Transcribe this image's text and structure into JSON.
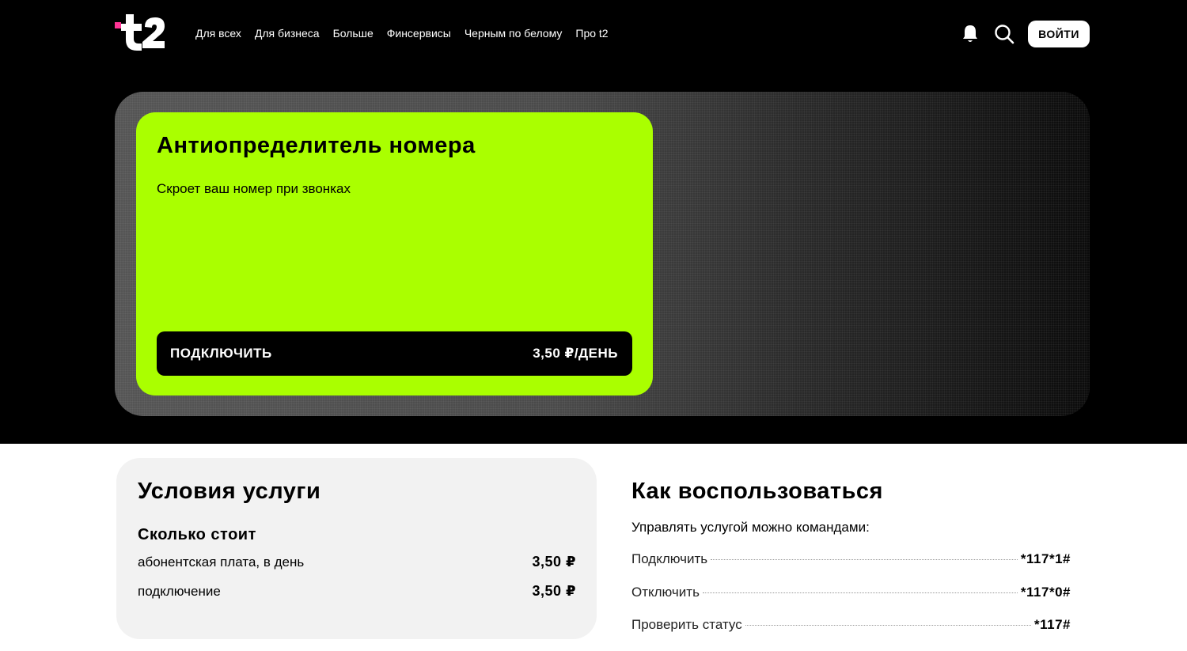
{
  "brand": {
    "logo_text": "t2",
    "accent_color": "#ff3495",
    "hero_color": "#aaff00"
  },
  "nav": {
    "items": [
      {
        "label": "Для всех"
      },
      {
        "label": "Для бизнеса"
      },
      {
        "label": "Больше"
      },
      {
        "label": "Финсервисы"
      },
      {
        "label": "Черным по белому"
      },
      {
        "label": "Про t2"
      }
    ],
    "icons": [
      "bell-icon",
      "search-icon"
    ],
    "login_label": "ВОЙТИ"
  },
  "hero": {
    "title": "Антиопределитель номера",
    "subtitle": "Скроет ваш номер при звонках",
    "cta_label": "ПОДКЛЮЧИТЬ",
    "cta_price": "3,50 ₽/ДЕНЬ"
  },
  "conditions": {
    "title": "Условия услуги",
    "subtitle": "Сколько стоит",
    "rows": [
      {
        "label": "абонентская плата, в день",
        "value": "3,50 ₽"
      },
      {
        "label": "подключение",
        "value": "3,50 ₽"
      }
    ]
  },
  "how": {
    "title": "Как воспользоваться",
    "intro": "Управлять услугой можно командами:",
    "commands": [
      {
        "label": "Подключить",
        "code": "*117*1#"
      },
      {
        "label": "Отключить",
        "code": "*117*0#"
      },
      {
        "label": "Проверить статус",
        "code": "*117#"
      }
    ]
  }
}
